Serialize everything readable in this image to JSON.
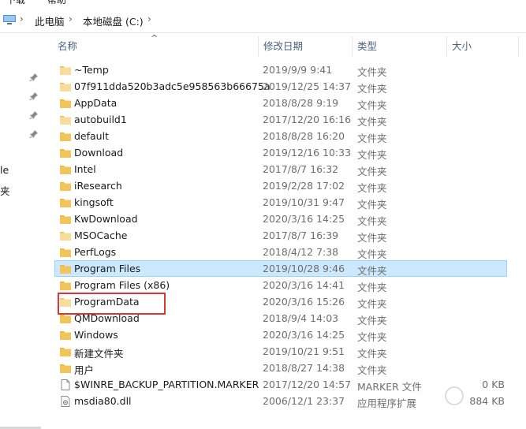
{
  "top_fragments": [
    "下载",
    "帮助"
  ],
  "breadcrumb": {
    "items": [
      "此电脑",
      "本地磁盘 (C:)"
    ]
  },
  "sort_indicator": "^",
  "nav": {
    "fragments": [
      "le",
      "夹"
    ]
  },
  "columns": {
    "name": "名称",
    "date": "修改日期",
    "type": "类型",
    "size": "大小"
  },
  "files": [
    {
      "name": "~Temp",
      "date": "2019/9/9 9:41",
      "type": "文件夹",
      "size": "",
      "icon": "folder-light-icon"
    },
    {
      "name": "07f911dda520b3adc5e958563b66675a",
      "date": "2019/12/25 14:37",
      "type": "文件夹",
      "size": "",
      "icon": "folder-light-icon"
    },
    {
      "name": "AppData",
      "date": "2018/8/28 9:19",
      "type": "文件夹",
      "size": "",
      "icon": "folder-icon"
    },
    {
      "name": "autobuild1",
      "date": "2017/12/20 16:16",
      "type": "文件夹",
      "size": "",
      "icon": "folder-light-icon"
    },
    {
      "name": "default",
      "date": "2018/8/28 16:20",
      "type": "文件夹",
      "size": "",
      "icon": "folder-icon"
    },
    {
      "name": "Download",
      "date": "2019/12/16 10:33",
      "type": "文件夹",
      "size": "",
      "icon": "folder-icon"
    },
    {
      "name": "Intel",
      "date": "2017/8/7 16:32",
      "type": "文件夹",
      "size": "",
      "icon": "folder-icon"
    },
    {
      "name": "iResearch",
      "date": "2019/2/28 17:02",
      "type": "文件夹",
      "size": "",
      "icon": "folder-icon"
    },
    {
      "name": "kingsoft",
      "date": "2019/10/31 9:47",
      "type": "文件夹",
      "size": "",
      "icon": "folder-icon"
    },
    {
      "name": "KwDownload",
      "date": "2020/3/16 14:25",
      "type": "文件夹",
      "size": "",
      "icon": "folder-icon"
    },
    {
      "name": "MSOCache",
      "date": "2017/8/7 16:39",
      "type": "文件夹",
      "size": "",
      "icon": "folder-light-icon"
    },
    {
      "name": "PerfLogs",
      "date": "2018/4/12 7:38",
      "type": "文件夹",
      "size": "",
      "icon": "folder-icon"
    },
    {
      "name": "Program Files",
      "date": "2019/10/28 9:46",
      "type": "文件夹",
      "size": "",
      "icon": "folder-icon",
      "selected": true
    },
    {
      "name": "Program Files (x86)",
      "date": "2020/3/16 14:41",
      "type": "文件夹",
      "size": "",
      "icon": "folder-icon"
    },
    {
      "name": "ProgramData",
      "date": "2020/3/16 15:26",
      "type": "文件夹",
      "size": "",
      "icon": "folder-light-icon"
    },
    {
      "name": "QMDownload",
      "date": "2018/9/4 14:03",
      "type": "文件夹",
      "size": "",
      "icon": "folder-icon"
    },
    {
      "name": "Windows",
      "date": "2020/3/16 14:25",
      "type": "文件夹",
      "size": "",
      "icon": "folder-icon"
    },
    {
      "name": "新建文件夹",
      "date": "2019/10/21 9:51",
      "type": "文件夹",
      "size": "",
      "icon": "folder-icon"
    },
    {
      "name": "用户",
      "date": "2018/8/27 14:38",
      "type": "文件夹",
      "size": "",
      "icon": "folder-icon"
    },
    {
      "name": "$WINRE_BACKUP_PARTITION.MARKER",
      "date": "2017/12/20 14:57",
      "type": "MARKER 文件",
      "size": "0 KB",
      "icon": "file-icon"
    },
    {
      "name": "msdia80.dll",
      "date": "2006/12/1 23:37",
      "type": "应用程序扩展",
      "size": "884 KB",
      "icon": "dll-file-icon"
    }
  ],
  "annotation": {
    "highlighted_item": "ProgramData",
    "color": "#e0342e"
  },
  "colors": {
    "folder": "#f2c55c",
    "folder_light": "#f7dc9a",
    "selection_bg": "#cce8ff",
    "selection_border": "#99d1ff",
    "header_text": "#4d6082"
  }
}
